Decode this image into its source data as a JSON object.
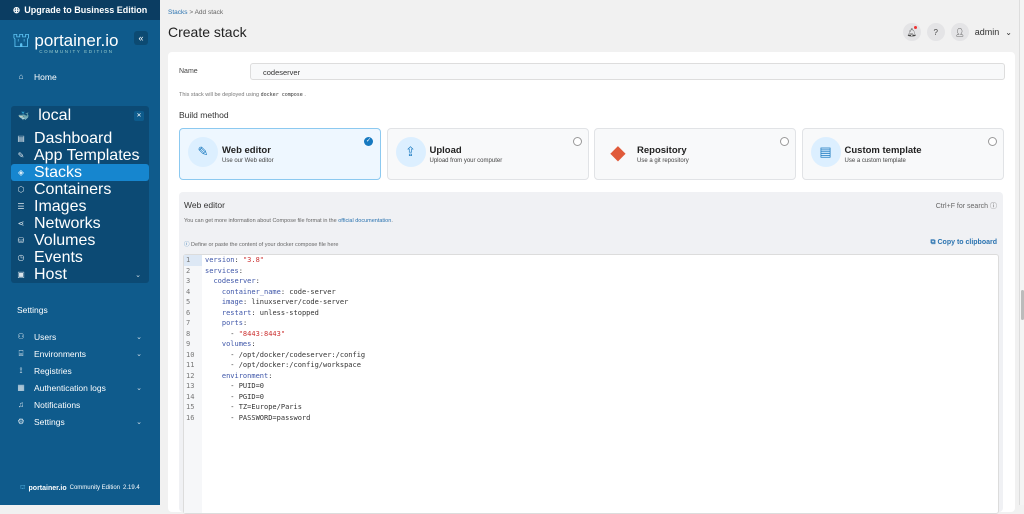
{
  "sidebar": {
    "upgrade": "Upgrade to Business Edition",
    "logo": "portainer.io",
    "logo_sub": "COMMUNITY EDITION",
    "home": "Home",
    "env_name": "local",
    "env_items": [
      "Dashboard",
      "App Templates",
      "Stacks",
      "Containers",
      "Images",
      "Networks",
      "Volumes",
      "Events",
      "Host"
    ],
    "settings_title": "Settings",
    "settings_items": [
      "Users",
      "Environments",
      "Registries",
      "Authentication logs",
      "Notifications",
      "Settings"
    ],
    "footer_logo": "portainer.io",
    "footer_edition": "Community Edition",
    "footer_version": "2.19.4"
  },
  "header": {
    "breadcrumb_link": "Stacks",
    "breadcrumb_sep": ">",
    "breadcrumb_current": "Add stack",
    "title": "Create stack",
    "user": "admin"
  },
  "form": {
    "name_label": "Name",
    "name_value": "codeserver",
    "hint_pre": "This stack will be deployed using",
    "hint_code": "docker compose",
    "hint_post": ".",
    "build_method": "Build method",
    "options": [
      {
        "title": "Web editor",
        "desc": "Use our Web editor",
        "selected": true
      },
      {
        "title": "Upload",
        "desc": "Upload from your computer",
        "selected": false
      },
      {
        "title": "Repository",
        "desc": "Use a git repository",
        "selected": false
      },
      {
        "title": "Custom template",
        "desc": "Use a custom template",
        "selected": false
      }
    ]
  },
  "editor": {
    "title": "Web editor",
    "search_hint": "Ctrl+F for search",
    "info_pre": "You can get more information about Compose file format in the",
    "info_link": "official documentation",
    "info_post": ".",
    "define_hint": "Define or paste the content of your docker compose file here",
    "copy": "Copy to clipboard",
    "lines": [
      [
        [
          "k",
          "version"
        ],
        [
          "",
          ": "
        ],
        [
          "s",
          "\"3.8\""
        ]
      ],
      [
        [
          "k",
          "services"
        ],
        [
          "",
          ":"
        ]
      ],
      [
        [
          "",
          "  "
        ],
        [
          "k",
          "codeserver"
        ],
        [
          "",
          ":"
        ]
      ],
      [
        [
          "",
          "    "
        ],
        [
          "k",
          "container_name"
        ],
        [
          "",
          ": code-server"
        ]
      ],
      [
        [
          "",
          "    "
        ],
        [
          "k",
          "image"
        ],
        [
          "",
          ": linuxserver/code-server"
        ]
      ],
      [
        [
          "",
          "    "
        ],
        [
          "k",
          "restart"
        ],
        [
          "",
          ": unless-stopped"
        ]
      ],
      [
        [
          "",
          "    "
        ],
        [
          "k",
          "ports"
        ],
        [
          "",
          ":"
        ]
      ],
      [
        [
          "",
          "      - "
        ],
        [
          "s",
          "\"8443:8443\""
        ]
      ],
      [
        [
          "",
          "    "
        ],
        [
          "k",
          "volumes"
        ],
        [
          "",
          ":"
        ]
      ],
      [
        [
          "",
          "      - /opt/docker/codeserver:/config"
        ]
      ],
      [
        [
          "",
          "      - /opt/docker:/config/workspace"
        ]
      ],
      [
        [
          "",
          "    "
        ],
        [
          "k",
          "environment"
        ],
        [
          "",
          ":"
        ]
      ],
      [
        [
          "",
          "      - PUID=0"
        ]
      ],
      [
        [
          "",
          "      - PGID=0"
        ]
      ],
      [
        [
          "",
          "      - TZ=Europe/Paris"
        ]
      ],
      [
        [
          "",
          "      - PASSWORD=password"
        ]
      ]
    ]
  }
}
